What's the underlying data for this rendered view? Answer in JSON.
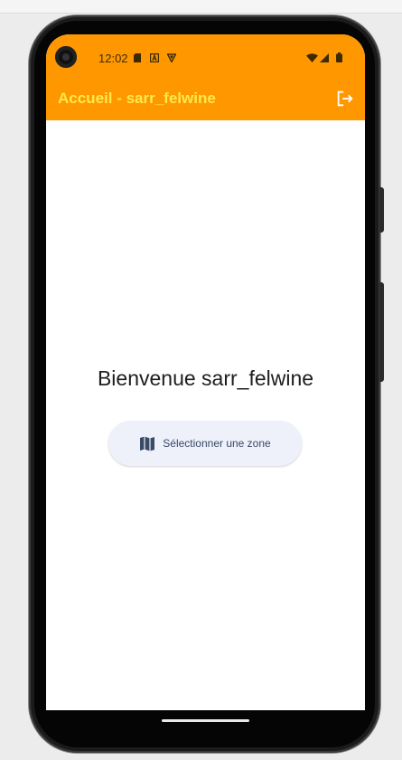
{
  "status_bar": {
    "time": "12:02",
    "notification_icons": [
      "sd-card-icon",
      "a-box-icon",
      "vpn-shield-icon"
    ],
    "system_icons": [
      "wifi-icon",
      "signal-icon",
      "battery-icon"
    ]
  },
  "app_bar": {
    "title": "Accueil - sarr_felwine",
    "action_icon": "logout-icon"
  },
  "main": {
    "welcome_text": "Bienvenue sarr_felwine",
    "select_zone_button": {
      "label": "Sélectionner une zone",
      "icon": "map-icon"
    }
  },
  "colors": {
    "app_bar_bg": "#ff9800",
    "title_color": "#ffe94a",
    "button_bg": "#eef0fa",
    "button_text": "#3a4b66"
  }
}
